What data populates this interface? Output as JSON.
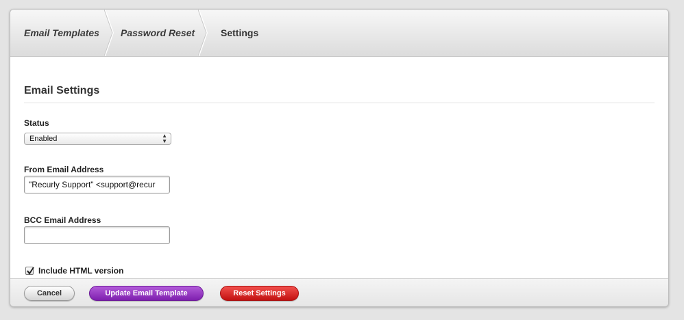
{
  "breadcrumb": {
    "items": [
      {
        "label": "Email Templates"
      },
      {
        "label": "Password Reset"
      },
      {
        "label": "Settings"
      }
    ]
  },
  "section": {
    "title": "Email Settings"
  },
  "form": {
    "status": {
      "label": "Status",
      "value": "Enabled"
    },
    "from_email": {
      "label": "From Email Address",
      "value": "\"Recurly Support\" <support@recur"
    },
    "bcc_email": {
      "label": "BCC Email Address",
      "value": ""
    },
    "include_html": {
      "label": "Include HTML version",
      "checked": true
    }
  },
  "footer": {
    "cancel_label": "Cancel",
    "update_label": "Update Email Template",
    "reset_label": "Reset Settings"
  },
  "colors": {
    "update_button": "#8e2bc0",
    "reset_button": "#d61c1c"
  }
}
